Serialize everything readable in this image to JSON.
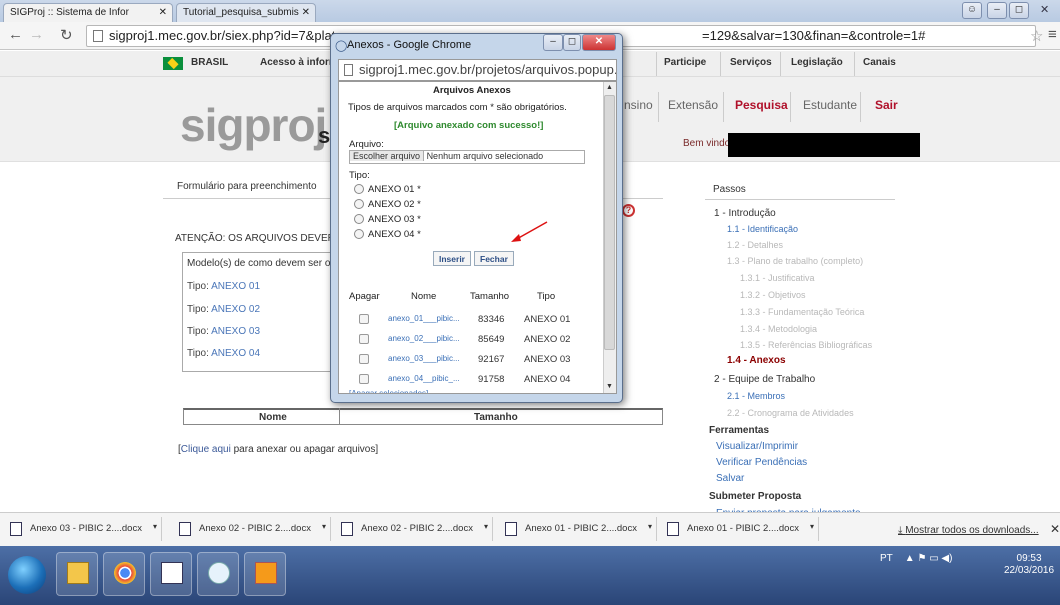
{
  "browser": {
    "tab1": "SIGProj :: Sistema de Infor",
    "tab2": "Tutorial_pesquisa_submis",
    "url": "sigproj1.mec.gov.br/siex.php?id=7&plata",
    "url_tail": "=129&salvar=130&finan=&controle=1#"
  },
  "govbar": {
    "brasil": "BRASIL",
    "acesso": "Acesso à inform",
    "items": [
      "Participe",
      "Serviços",
      "Legislação",
      "Canais"
    ]
  },
  "header": {
    "logo": "sigproj",
    "logo_tail": "s",
    "nav": [
      "nsino",
      "Extensão",
      "Pesquisa",
      "Estudante",
      "Sair"
    ],
    "welcome": "Bem vindo(a"
  },
  "main": {
    "form_header": "Formulário para preenchimento",
    "atencao": "ATENÇÃO: OS ARQUIVOS DEVERÃ",
    "modelos_title": "Modelo(s) de como devem ser os",
    "modelos": [
      {
        "label": "Tipo:",
        "value": "ANEXO 01"
      },
      {
        "label": "Tipo:",
        "value": "ANEXO 02"
      },
      {
        "label": "Tipo:",
        "value": "ANEXO 03"
      },
      {
        "label": "Tipo:",
        "value": "ANEXO 04"
      }
    ],
    "col_nome": "Nome",
    "col_tamanho": "Tamanho",
    "clique_prefix": "[",
    "clique_link": "Clique aqui",
    "clique_text": "para anexar ou apagar arquivos]"
  },
  "sidebar": {
    "title": "Passos",
    "items": [
      {
        "text": "1 - Introdução",
        "cls": "lvl1"
      },
      {
        "text": "1.1 - Identificação",
        "cls": "link"
      },
      {
        "text": "1.2 - Detalhes",
        "cls": "dim"
      },
      {
        "text": "1.3 - Plano de trabalho (completo)",
        "cls": "dim"
      },
      {
        "text": "1.3.1 - Justificativa",
        "cls": "dim"
      },
      {
        "text": "1.3.2 - Objetivos",
        "cls": "dim"
      },
      {
        "text": "1.3.3 - Fundamentação Teórica",
        "cls": "dim"
      },
      {
        "text": "1.3.4 - Metodologia",
        "cls": "dim"
      },
      {
        "text": "1.3.5 - Referências Bibliográficas",
        "cls": "dim"
      },
      {
        "text": "1.4 - Anexos",
        "cls": "cur"
      },
      {
        "text": "2 - Equipe de Trabalho",
        "cls": "lvl1"
      },
      {
        "text": "2.1 - Membros",
        "cls": "link"
      },
      {
        "text": "2.2 - Cronograma de Atividades",
        "cls": "dim"
      }
    ],
    "ferramentas": "Ferramentas",
    "tools": [
      "Visualizar/Imprimir",
      "Verificar Pendências",
      "Salvar"
    ],
    "submeter": "Submeter Proposta",
    "enviar": "Enviar proposta para julgamento"
  },
  "popup": {
    "window_title": "Anexos - Google Chrome",
    "url": "sigproj1.mec.gov.br/projetos/arquivos.popup.p",
    "heading": "Arquivos Anexos",
    "subheading": "Tipos de arquivos marcados com * são obrigatórios.",
    "success": "[Arquivo anexado com sucesso!]",
    "arquivo_label": "Arquivo:",
    "file_button": "Escolher arquivo",
    "file_status": "Nenhum arquivo selecionado",
    "tipo_label": "Tipo:",
    "tipos": [
      "ANEXO 01 *",
      "ANEXO 02 *",
      "ANEXO 03 *",
      "ANEXO 04 *"
    ],
    "inserir": "Inserir",
    "fechar": "Fechar",
    "cols": [
      "Apagar",
      "Nome",
      "Tamanho",
      "Tipo"
    ],
    "files": [
      {
        "nome": "anexo_01___pibic...",
        "tamanho": "83346",
        "tipo": "ANEXO 01"
      },
      {
        "nome": "anexo_02___pibic...",
        "tamanho": "85649",
        "tipo": "ANEXO 02"
      },
      {
        "nome": "anexo_03___pibic...",
        "tamanho": "92167",
        "tipo": "ANEXO 03"
      },
      {
        "nome": "anexo_04__pibic_...",
        "tamanho": "91758",
        "tipo": "ANEXO 04"
      }
    ],
    "apagar_link": "[Apagar selecionados]"
  },
  "downloads": {
    "items": [
      "Anexo 03 - PIBIC 2....docx",
      "Anexo 02 - PIBIC 2....docx",
      "Anexo 02 - PIBIC 2....docx",
      "Anexo 01 - PIBIC 2....docx",
      "Anexo 01 - PIBIC 2....docx"
    ],
    "show_all": "Mostrar todos os downloads..."
  },
  "taskbar": {
    "lang": "PT",
    "time": "09:53",
    "date": "22/03/2016"
  }
}
